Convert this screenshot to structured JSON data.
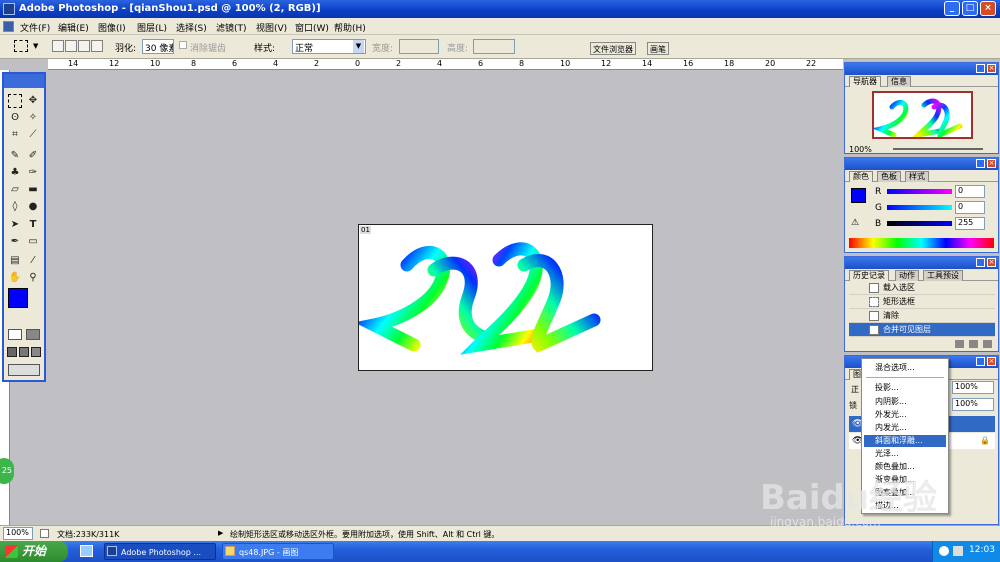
{
  "window": {
    "title": "Adobe Photoshop - [qianShou1.psd @ 100% (2, RGB)]"
  },
  "menu": [
    "文件(F)",
    "编辑(E)",
    "图像(I)",
    "图层(L)",
    "选择(S)",
    "滤镜(T)",
    "视图(V)",
    "窗口(W)",
    "帮助(H)"
  ],
  "options": {
    "feather_label": "羽化:",
    "feather_value": "30 像素",
    "antialias_label": "消除锯齿",
    "style_label": "样式:",
    "style_value": "正常",
    "width_label": "宽度:",
    "height_label": "高度:",
    "tab_browser": "文件浏览器",
    "tab_brush": "画笔"
  },
  "ruler": {
    "top": [
      "14",
      "12",
      "10",
      "8",
      "6",
      "4",
      "2",
      "0",
      "2",
      "4",
      "6",
      "8",
      "10",
      "12",
      "14",
      "16",
      "18",
      "20",
      "22"
    ]
  },
  "canvas": {
    "tag": "01"
  },
  "navigator": {
    "tabs": [
      "导航器",
      "信息"
    ],
    "zoom": "100%"
  },
  "color": {
    "tabs": [
      "颜色",
      "色板",
      "样式"
    ],
    "r_label": "R",
    "g_label": "G",
    "b_label": "B",
    "r": "0",
    "g": "0",
    "b": "255",
    "fg_color": "#0000ff"
  },
  "history": {
    "tabs": [
      "历史记录",
      "动作",
      "工具预设"
    ],
    "items": [
      {
        "label": "载入选区"
      },
      {
        "label": "矩形选框"
      },
      {
        "label": "清除"
      },
      {
        "label": "合并可见图层"
      }
    ]
  },
  "layers": {
    "tab": "图",
    "blend_short": "正",
    "lock_short": "锁",
    "opacity": "100%",
    "fill": "100%"
  },
  "context_menu": {
    "items": [
      "混合选项...",
      "投影...",
      "内阴影...",
      "外发光...",
      "内发光...",
      "斜面和浮雕...",
      "光泽...",
      "颜色叠加...",
      "渐变叠加...",
      "图案叠加...",
      "描边..."
    ],
    "selected": "斜面和浮雕..."
  },
  "statusbar": {
    "zoom": "100%",
    "doc": "文档:233K/311K",
    "hint": "绘制矩形选区或移动选区外框。要用附加选项，使用 Shift、Alt 和 Ctrl 键。"
  },
  "taskbar": {
    "start": "开始",
    "tasks": [
      "Adobe Photoshop ...",
      "qs48.JPG - 画图"
    ],
    "clock": "12:03"
  },
  "watermark": {
    "main": "Baidu经验",
    "sub": "jingyan.baidu.com"
  },
  "badge": "25"
}
